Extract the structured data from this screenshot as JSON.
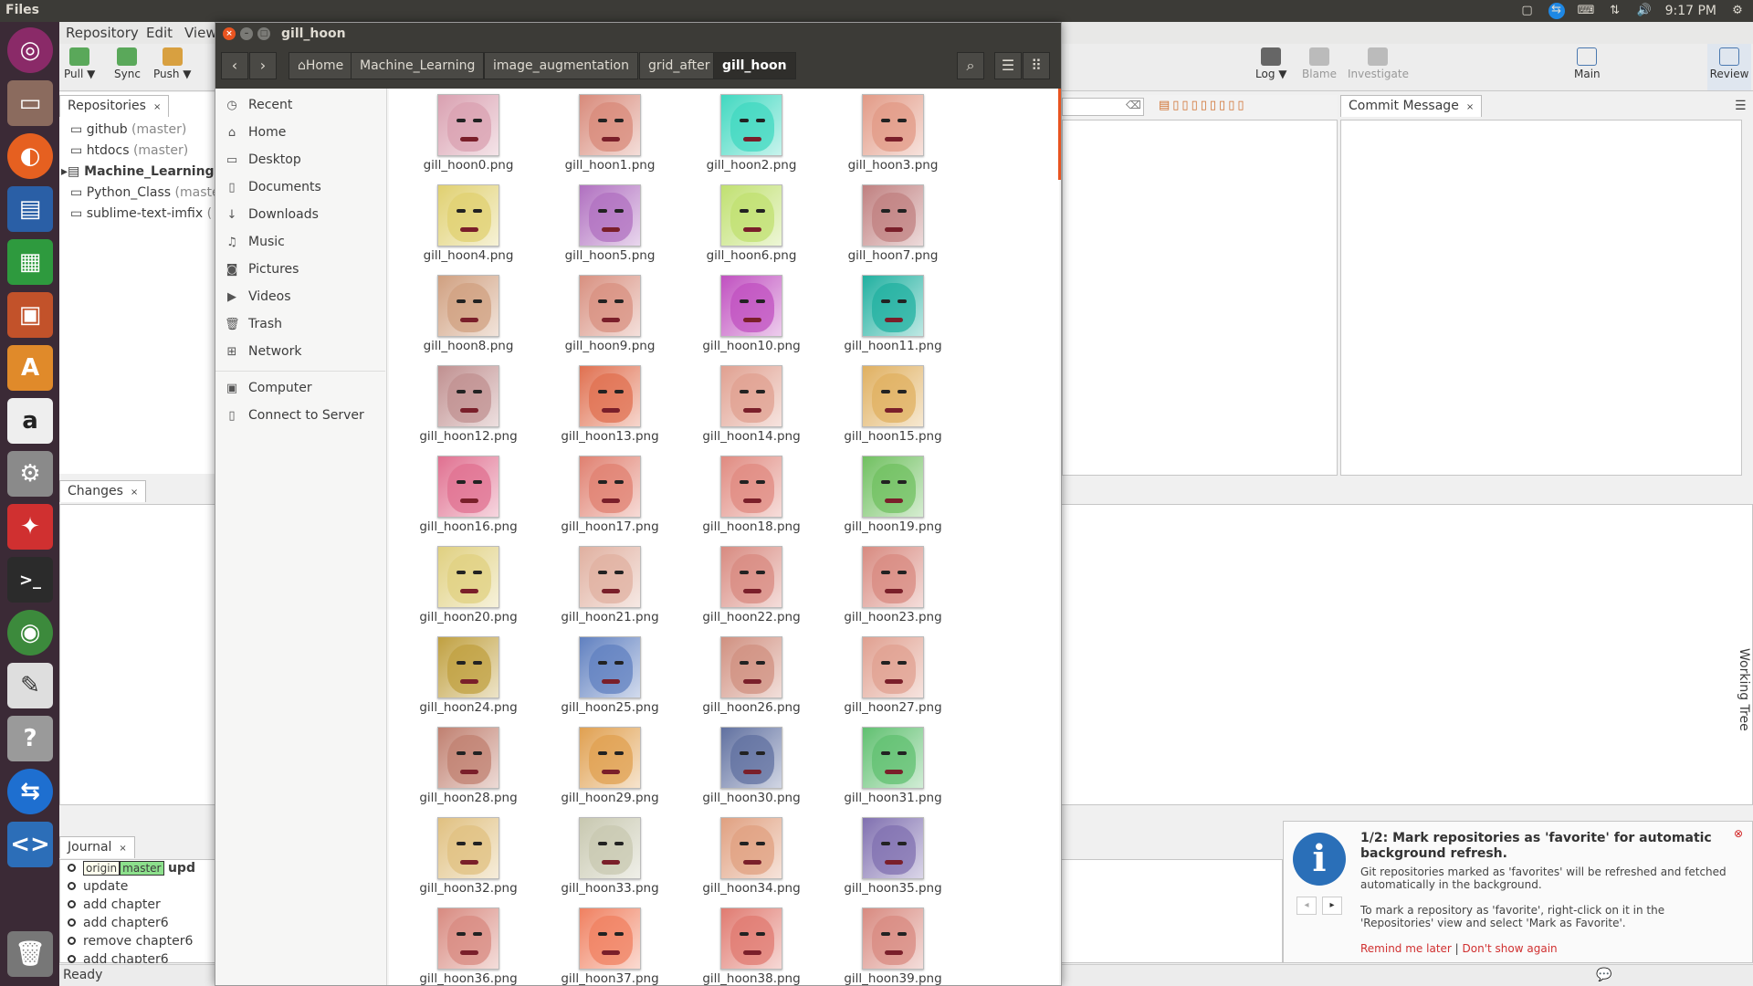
{
  "topbar": {
    "app_name": "Files",
    "time": "9:17 PM"
  },
  "launcher": {
    "items": [
      "ubuntu-logo-icon",
      "files-icon",
      "firefox-icon",
      "writer-icon",
      "calc-icon",
      "impress-icon",
      "software-center-icon",
      "amazon-icon",
      "settings-icon",
      "app-icon",
      "terminal-icon",
      "chrome-icon",
      "text-editor-icon",
      "help-icon",
      "teamviewer-icon",
      "code-icon",
      "trash-icon"
    ]
  },
  "smartgit": {
    "menu": [
      "Repository",
      "Edit",
      "View"
    ],
    "toolbar_left": [
      "Pull ▼",
      "Sync",
      "Push ▼"
    ],
    "toolbar_right": [
      "Log ▼",
      "Blame",
      "Investigate",
      "Main",
      "Review"
    ],
    "repositories_tab": "Repositories",
    "repos": [
      {
        "name": "github",
        "branch": "(master)"
      },
      {
        "name": "htdocs",
        "branch": "(master)"
      },
      {
        "name": "Machine_Learning",
        "branch": ""
      },
      {
        "name": "Python_Class",
        "branch": "(maste"
      },
      {
        "name": "sublime-text-imfix",
        "branch": "("
      }
    ],
    "commit_message_tab": "Commit Message",
    "changes_tab": "Changes",
    "journal_tab": "Journal",
    "journal": {
      "labels": [
        "origin",
        "master"
      ],
      "first_message": "upd",
      "entries": [
        "update",
        "add chapter",
        "add chapter6",
        "remove chapter6",
        "add chapter6"
      ]
    },
    "working_tree_label": "Working Tree",
    "status": "Ready"
  },
  "nautilus": {
    "title": "gill_hoon",
    "breadcrumbs": [
      "Home",
      "Machine_Learning",
      "image_augmentation",
      "grid_after",
      "gill_hoon"
    ],
    "sidebar": [
      {
        "label": "Recent",
        "icon": "clock-icon"
      },
      {
        "label": "Home",
        "icon": "home-icon"
      },
      {
        "label": "Desktop",
        "icon": "folder-icon"
      },
      {
        "label": "Documents",
        "icon": "document-icon"
      },
      {
        "label": "Downloads",
        "icon": "download-icon"
      },
      {
        "label": "Music",
        "icon": "music-icon"
      },
      {
        "label": "Pictures",
        "icon": "camera-icon"
      },
      {
        "label": "Videos",
        "icon": "video-icon"
      },
      {
        "label": "Trash",
        "icon": "trash-icon"
      },
      {
        "label": "Network",
        "icon": "network-icon"
      },
      {
        "label": "Computer",
        "icon": "computer-icon"
      },
      {
        "label": "Connect to Server",
        "icon": "server-icon"
      }
    ],
    "files": [
      "gill_hoon0.png",
      "gill_hoon1.png",
      "gill_hoon2.png",
      "gill_hoon3.png",
      "gill_hoon4.png",
      "gill_hoon5.png",
      "gill_hoon6.png",
      "gill_hoon7.png",
      "gill_hoon8.png",
      "gill_hoon9.png",
      "gill_hoon10.png",
      "gill_hoon11.png",
      "gill_hoon12.png",
      "gill_hoon13.png",
      "gill_hoon14.png",
      "gill_hoon15.png",
      "gill_hoon16.png",
      "gill_hoon17.png",
      "gill_hoon18.png",
      "gill_hoon19.png",
      "gill_hoon20.png",
      "gill_hoon21.png",
      "gill_hoon22.png",
      "gill_hoon23.png",
      "gill_hoon24.png",
      "gill_hoon25.png",
      "gill_hoon26.png",
      "gill_hoon27.png",
      "gill_hoon28.png",
      "gill_hoon29.png",
      "gill_hoon30.png",
      "gill_hoon31.png",
      "gill_hoon32.png",
      "gill_hoon33.png",
      "gill_hoon34.png",
      "gill_hoon35.png",
      "gill_hoon36.png",
      "gill_hoon37.png",
      "gill_hoon38.png",
      "gill_hoon39.png"
    ],
    "thumb_colors": [
      "#d9a0b0",
      "#d88a7a",
      "#40d8c0",
      "#e29a86",
      "#e0d070",
      "#b070c0",
      "#c0e070",
      "#c08080",
      "#d0a080",
      "#d89080",
      "#c050c0",
      "#20b0a0",
      "#c09090",
      "#e07050",
      "#e0a090",
      "#e0b060",
      "#e07090",
      "#e08070",
      "#e08a80",
      "#70c060",
      "#e0d080",
      "#e0b0a0",
      "#d88a80",
      "#d88a80",
      "#c0a040",
      "#6080c0",
      "#d09080",
      "#e0a090",
      "#c08070",
      "#e0a050",
      "#6070a0",
      "#60c070",
      "#e0c080",
      "#c8c8b0",
      "#e0a080",
      "#8070b0",
      "#d88a80",
      "#f08060",
      "#e07a70",
      "#d88a80"
    ]
  },
  "notification": {
    "title": "1/2: Mark repositories as 'favorite' for automatic background refresh.",
    "body1": "Git repositories marked as 'favorites' will be refreshed and fetched automatically in the background.",
    "body2": "To mark a repository as 'favorite', right-click on it in the 'Repositories' view and select 'Mark as Favorite'.",
    "remind": "Remind me later",
    "separator": "|",
    "dont_show": "Don't show again"
  }
}
